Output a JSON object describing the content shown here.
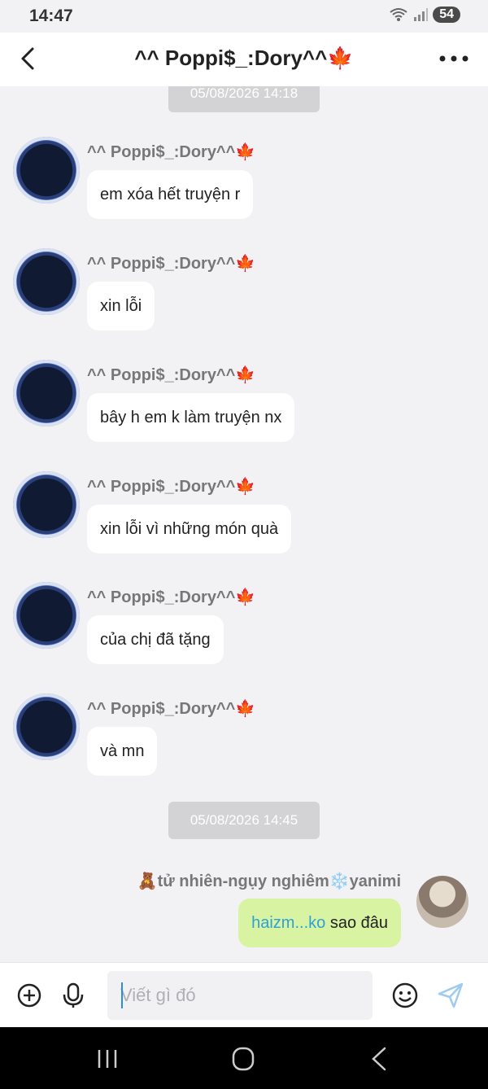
{
  "status": {
    "time": "14:47",
    "battery": "54"
  },
  "header": {
    "title": "^^ Poppi$_:Dory^^🍁"
  },
  "timestamps": {
    "top": "05/08/2026 14:18",
    "second": "05/08/2026 14:45"
  },
  "messages": [
    {
      "sender": "^^ Poppi$_:Dory^^🍁",
      "text": "em xóa hết truyện r"
    },
    {
      "sender": "^^ Poppi$_:Dory^^🍁",
      "text": "xin lỗi"
    },
    {
      "sender": "^^ Poppi$_:Dory^^🍁",
      "text": "bây h em k làm truyện nx"
    },
    {
      "sender": "^^ Poppi$_:Dory^^🍁",
      "text": "xin lỗi vì những món quà"
    },
    {
      "sender": "^^ Poppi$_:Dory^^🍁",
      "text": "của chị đã tặng"
    },
    {
      "sender": "^^ Poppi$_:Dory^^🍁",
      "text": "và mn"
    }
  ],
  "my_message": {
    "sender": "🧸tử nhiên-ngụy nghiêm❄️yanimi",
    "link_text": "haizm...ko",
    "text": " sao đâu"
  },
  "composer": {
    "placeholder": "Viết gì đó"
  },
  "colors": {
    "my_bubble": "#d8f4a3",
    "link": "#2ea0d8",
    "accent": "#2a8fd8"
  }
}
